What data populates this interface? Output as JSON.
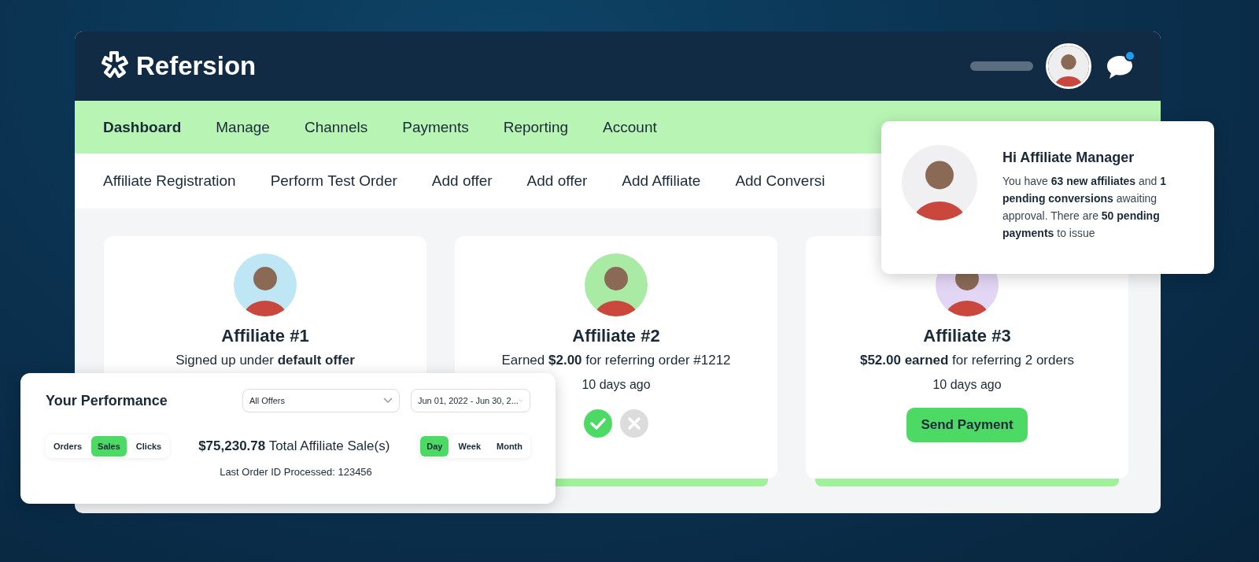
{
  "header": {
    "logo": "Refersion"
  },
  "nav": [
    {
      "label": "Dashboard",
      "selected": true
    },
    {
      "label": "Manage",
      "selected": false
    },
    {
      "label": "Channels",
      "selected": false
    },
    {
      "label": "Payments",
      "selected": false
    },
    {
      "label": "Reporting",
      "selected": false
    },
    {
      "label": "Account",
      "selected": false
    }
  ],
  "actions": [
    "Affiliate Registration",
    "Perform Test Order",
    "Add offer",
    "Add offer",
    "Add Affiliate",
    "Add Conversi"
  ],
  "cards": [
    {
      "name": "Affiliate #1",
      "description": "Signed up under **default offer**"
    },
    {
      "name": "Affiliate #2",
      "description": "Earned **$2.00** for referring order #1212",
      "time": "10 days ago",
      "kind": "approve"
    },
    {
      "name": "Affiliate #3",
      "description": "**$52.00 earned** for referring 2 orders",
      "time": "10 days ago",
      "kind": "pay",
      "button": "Send Payment"
    }
  ],
  "performance": {
    "title": "Your Performance",
    "offer_select": "All Offers",
    "date_select": "Jun 01, 2022 - Jun 30, 2...",
    "metrics": [
      {
        "label": "Orders",
        "selected": false
      },
      {
        "label": "Sales",
        "selected": true
      },
      {
        "label": "Clicks",
        "selected": false
      }
    ],
    "total": "$75,230.78",
    "total_label": "Total Affiliate Sale(s)",
    "last_order": "Last Order ID Processed: 123456",
    "periods": [
      {
        "label": "Day",
        "selected": true
      },
      {
        "label": "Week",
        "selected": false
      },
      {
        "label": "Month",
        "selected": false
      }
    ]
  },
  "notification": {
    "title": "Hi Affiliate Manager",
    "message": "You have **63 new affiliates** and **1 pending conversions** awaiting approval. There are **50 pending payments** to issue"
  }
}
